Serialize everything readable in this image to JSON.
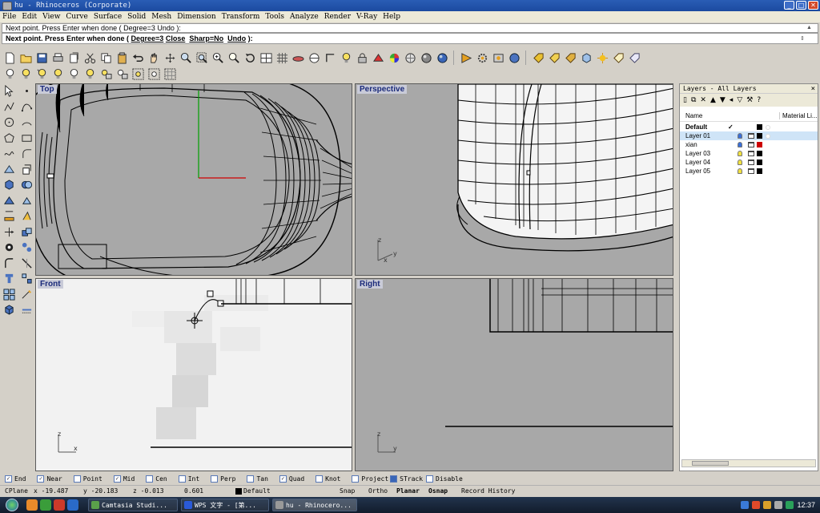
{
  "window": {
    "title": "hu - Rhinoceros (Corporate)"
  },
  "menu": [
    "File",
    "Edit",
    "View",
    "Curve",
    "Surface",
    "Solid",
    "Mesh",
    "Dimension",
    "Transform",
    "Tools",
    "Analyze",
    "Render",
    "V-Ray",
    "Help"
  ],
  "command": {
    "history": "Next point. Press Enter when done ( Degree=3  Undo ):",
    "prompt_lead": "Next point. Press Enter when done ( ",
    "opt_degree": "Degree=3",
    "opt_close": "Close",
    "opt_sharp": "Sharp=No",
    "opt_undo": "Undo",
    "prompt_tail": " ):"
  },
  "viewports": {
    "top": "Top",
    "perspective": "Perspective",
    "front": "Front",
    "right": "Right"
  },
  "axes": {
    "x": "x",
    "y": "y",
    "z": "z"
  },
  "layers_panel": {
    "title": "Layers - All Layers",
    "col_name": "Name",
    "col_material": "Material Li...",
    "rows": [
      {
        "name": "Default",
        "current": "✓",
        "color": "#000000",
        "bulb": "off",
        "bold": true
      },
      {
        "name": "Layer 01",
        "current": "",
        "color": "#000000",
        "bulb": "blue",
        "selected": true
      },
      {
        "name": "xian",
        "current": "",
        "color": "#cc0000",
        "bulb": "blue"
      },
      {
        "name": "Layer 03",
        "current": "",
        "color": "#000000",
        "bulb": "yellow"
      },
      {
        "name": "Layer 04",
        "current": "",
        "color": "#000000",
        "bulb": "yellow"
      },
      {
        "name": "Layer 05",
        "current": "",
        "color": "#000000",
        "bulb": "yellow"
      }
    ]
  },
  "osnap": [
    {
      "label": "End",
      "checked": true
    },
    {
      "label": "Near",
      "checked": true
    },
    {
      "label": "Point",
      "checked": false
    },
    {
      "label": "Mid",
      "checked": true
    },
    {
      "label": "Cen",
      "checked": false
    },
    {
      "label": "Int",
      "checked": false
    },
    {
      "label": "Perp",
      "checked": false
    },
    {
      "label": "Tan",
      "checked": false
    },
    {
      "label": "Quad",
      "checked": true
    },
    {
      "label": "Knot",
      "checked": false
    },
    {
      "label": "Project",
      "checked": false
    },
    {
      "label": "STrack",
      "checked": true
    },
    {
      "label": "Disable",
      "checked": false
    }
  ],
  "status": {
    "cplane": "CPlane",
    "x": "x -19.487",
    "y": "y -20.183",
    "z": "z -0.013",
    "dist": "0.601",
    "layer": "Default",
    "snap": "Snap",
    "ortho": "Ortho",
    "planar": "Planar",
    "osnap": "Osnap",
    "history": "Record History"
  },
  "taskbar": {
    "tasks": [
      "Camtasia Studi...",
      "WPS 文字 - [第...",
      "hu - Rhinocero..."
    ],
    "clock": "12:37"
  },
  "colors": {
    "brand": "#1b4aa0",
    "viewport_bg": "#a8a8a8",
    "label": "#1a2a7a"
  }
}
